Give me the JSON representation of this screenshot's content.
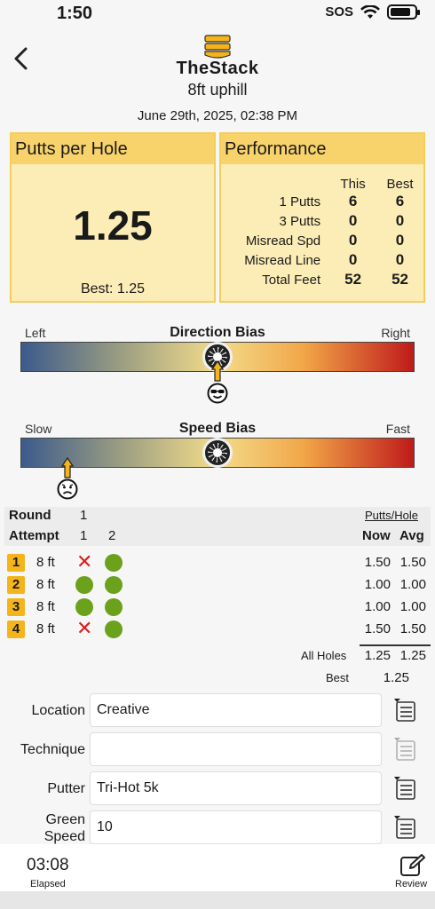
{
  "status": {
    "time": "1:50",
    "sos": "SOS"
  },
  "header": {
    "brand": "TheStack",
    "subtitle": "8ft uphill",
    "datetime": "June 29th, 2025,  02:38 PM"
  },
  "putts_per_hole": {
    "title": "Putts per Hole",
    "value": "1.25",
    "best": "Best: 1.25"
  },
  "performance": {
    "title": "Performance",
    "col_this": "This",
    "col_best": "Best",
    "rows": [
      {
        "label": "1 Putts",
        "this": "6",
        "best": "6"
      },
      {
        "label": "3 Putts",
        "this": "0",
        "best": "0"
      },
      {
        "label": "Misread Spd",
        "this": "0",
        "best": "0"
      },
      {
        "label": "Misread Line",
        "this": "0",
        "best": "0"
      },
      {
        "label": "Total Feet",
        "this": "52",
        "best": "52"
      }
    ]
  },
  "direction_bias": {
    "title": "Direction Bias",
    "left": "Left",
    "right": "Right",
    "marker_fraction": 0.5
  },
  "speed_bias": {
    "title": "Speed Bias",
    "left": "Slow",
    "right": "Fast",
    "marker_fraction": 0.12
  },
  "results": {
    "round_label": "Round",
    "round_value": "1",
    "attempt_label": "Attempt",
    "attempt_1": "1",
    "attempt_2": "2",
    "putts_hole_label": "Putts/Hole",
    "now_label": "Now",
    "avg_label": "Avg",
    "rows": [
      {
        "n": "1",
        "dist": "8 ft",
        "a1": "miss",
        "a2": "make",
        "now": "1.50",
        "avg": "1.50"
      },
      {
        "n": "2",
        "dist": "8 ft",
        "a1": "make",
        "a2": "make",
        "now": "1.00",
        "avg": "1.00"
      },
      {
        "n": "3",
        "dist": "8 ft",
        "a1": "make",
        "a2": "make",
        "now": "1.00",
        "avg": "1.00"
      },
      {
        "n": "4",
        "dist": "8 ft",
        "a1": "miss",
        "a2": "make",
        "now": "1.50",
        "avg": "1.50"
      }
    ],
    "all_holes_label": "All Holes",
    "all_now": "1.25",
    "all_avg": "1.25",
    "best_label": "Best",
    "best_value": "1.25"
  },
  "fields": {
    "location_label": "Location",
    "location_value": "Creative",
    "technique_label": "Technique",
    "technique_value": "",
    "putter_label": "Putter",
    "putter_value": "Tri-Hot 5k",
    "green_label_1": "Green",
    "green_label_2": "Speed",
    "green_value": "10"
  },
  "footer": {
    "elapsed": "03:08",
    "elapsed_label": "Elapsed",
    "review_label": "Review"
  },
  "colors": {
    "accent": "#f8d36b",
    "card_bg": "#fcedb7",
    "make": "#6ba11b",
    "miss": "#d62020",
    "badge": "#f4b41a"
  }
}
